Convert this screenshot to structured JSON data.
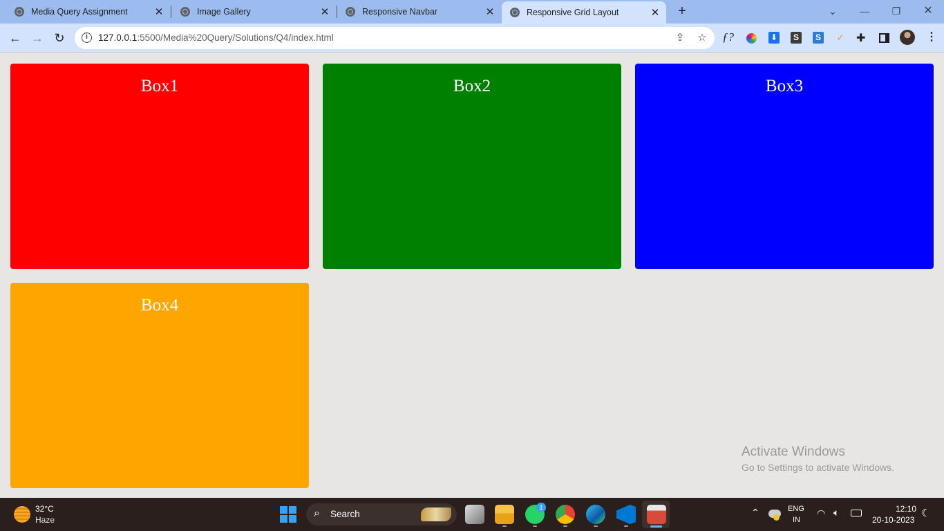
{
  "tabs": [
    {
      "title": "Media Query Assignment",
      "active": false
    },
    {
      "title": "Image Gallery",
      "active": false
    },
    {
      "title": "Responsive Navbar",
      "active": false
    },
    {
      "title": "Responsive Grid Layout",
      "active": true
    }
  ],
  "toolbar": {
    "url_host": "127.0.0.1",
    "url_rest": ":5500/Media%20Query/Solutions/Q4/index.html"
  },
  "boxes": [
    {
      "label": "Box1",
      "color": "#ff0000"
    },
    {
      "label": "Box2",
      "color": "#008000"
    },
    {
      "label": "Box3",
      "color": "#0000ff"
    },
    {
      "label": "Box4",
      "color": "#ffa500"
    }
  ],
  "watermark": {
    "line1": "Activate Windows",
    "line2": "Go to Settings to activate Windows."
  },
  "taskbar": {
    "weather_temp": "32°C",
    "weather_desc": "Haze",
    "search_label": "Search",
    "whatsapp_badge": "1",
    "lang_top": "ENG",
    "lang_bottom": "IN",
    "time": "12:10",
    "date": "20-10-2023"
  }
}
